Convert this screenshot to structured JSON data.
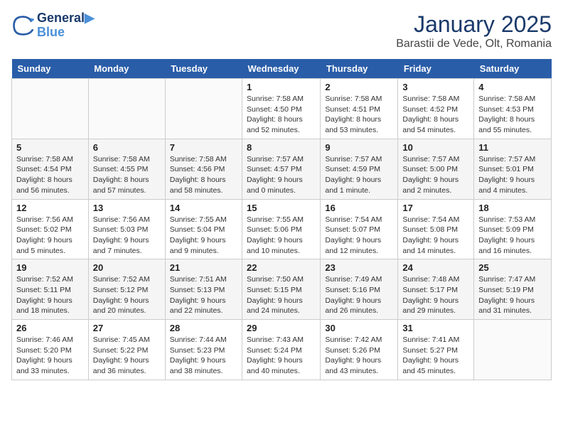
{
  "header": {
    "logo_line1": "General",
    "logo_line2": "Blue",
    "month": "January 2025",
    "location": "Barastii de Vede, Olt, Romania"
  },
  "weekdays": [
    "Sunday",
    "Monday",
    "Tuesday",
    "Wednesday",
    "Thursday",
    "Friday",
    "Saturday"
  ],
  "weeks": [
    [
      {
        "day": "",
        "info": ""
      },
      {
        "day": "",
        "info": ""
      },
      {
        "day": "",
        "info": ""
      },
      {
        "day": "1",
        "info": "Sunrise: 7:58 AM\nSunset: 4:50 PM\nDaylight: 8 hours and 52 minutes."
      },
      {
        "day": "2",
        "info": "Sunrise: 7:58 AM\nSunset: 4:51 PM\nDaylight: 8 hours and 53 minutes."
      },
      {
        "day": "3",
        "info": "Sunrise: 7:58 AM\nSunset: 4:52 PM\nDaylight: 8 hours and 54 minutes."
      },
      {
        "day": "4",
        "info": "Sunrise: 7:58 AM\nSunset: 4:53 PM\nDaylight: 8 hours and 55 minutes."
      }
    ],
    [
      {
        "day": "5",
        "info": "Sunrise: 7:58 AM\nSunset: 4:54 PM\nDaylight: 8 hours and 56 minutes."
      },
      {
        "day": "6",
        "info": "Sunrise: 7:58 AM\nSunset: 4:55 PM\nDaylight: 8 hours and 57 minutes."
      },
      {
        "day": "7",
        "info": "Sunrise: 7:58 AM\nSunset: 4:56 PM\nDaylight: 8 hours and 58 minutes."
      },
      {
        "day": "8",
        "info": "Sunrise: 7:57 AM\nSunset: 4:57 PM\nDaylight: 9 hours and 0 minutes."
      },
      {
        "day": "9",
        "info": "Sunrise: 7:57 AM\nSunset: 4:59 PM\nDaylight: 9 hours and 1 minute."
      },
      {
        "day": "10",
        "info": "Sunrise: 7:57 AM\nSunset: 5:00 PM\nDaylight: 9 hours and 2 minutes."
      },
      {
        "day": "11",
        "info": "Sunrise: 7:57 AM\nSunset: 5:01 PM\nDaylight: 9 hours and 4 minutes."
      }
    ],
    [
      {
        "day": "12",
        "info": "Sunrise: 7:56 AM\nSunset: 5:02 PM\nDaylight: 9 hours and 5 minutes."
      },
      {
        "day": "13",
        "info": "Sunrise: 7:56 AM\nSunset: 5:03 PM\nDaylight: 9 hours and 7 minutes."
      },
      {
        "day": "14",
        "info": "Sunrise: 7:55 AM\nSunset: 5:04 PM\nDaylight: 9 hours and 9 minutes."
      },
      {
        "day": "15",
        "info": "Sunrise: 7:55 AM\nSunset: 5:06 PM\nDaylight: 9 hours and 10 minutes."
      },
      {
        "day": "16",
        "info": "Sunrise: 7:54 AM\nSunset: 5:07 PM\nDaylight: 9 hours and 12 minutes."
      },
      {
        "day": "17",
        "info": "Sunrise: 7:54 AM\nSunset: 5:08 PM\nDaylight: 9 hours and 14 minutes."
      },
      {
        "day": "18",
        "info": "Sunrise: 7:53 AM\nSunset: 5:09 PM\nDaylight: 9 hours and 16 minutes."
      }
    ],
    [
      {
        "day": "19",
        "info": "Sunrise: 7:52 AM\nSunset: 5:11 PM\nDaylight: 9 hours and 18 minutes."
      },
      {
        "day": "20",
        "info": "Sunrise: 7:52 AM\nSunset: 5:12 PM\nDaylight: 9 hours and 20 minutes."
      },
      {
        "day": "21",
        "info": "Sunrise: 7:51 AM\nSunset: 5:13 PM\nDaylight: 9 hours and 22 minutes."
      },
      {
        "day": "22",
        "info": "Sunrise: 7:50 AM\nSunset: 5:15 PM\nDaylight: 9 hours and 24 minutes."
      },
      {
        "day": "23",
        "info": "Sunrise: 7:49 AM\nSunset: 5:16 PM\nDaylight: 9 hours and 26 minutes."
      },
      {
        "day": "24",
        "info": "Sunrise: 7:48 AM\nSunset: 5:17 PM\nDaylight: 9 hours and 29 minutes."
      },
      {
        "day": "25",
        "info": "Sunrise: 7:47 AM\nSunset: 5:19 PM\nDaylight: 9 hours and 31 minutes."
      }
    ],
    [
      {
        "day": "26",
        "info": "Sunrise: 7:46 AM\nSunset: 5:20 PM\nDaylight: 9 hours and 33 minutes."
      },
      {
        "day": "27",
        "info": "Sunrise: 7:45 AM\nSunset: 5:22 PM\nDaylight: 9 hours and 36 minutes."
      },
      {
        "day": "28",
        "info": "Sunrise: 7:44 AM\nSunset: 5:23 PM\nDaylight: 9 hours and 38 minutes."
      },
      {
        "day": "29",
        "info": "Sunrise: 7:43 AM\nSunset: 5:24 PM\nDaylight: 9 hours and 40 minutes."
      },
      {
        "day": "30",
        "info": "Sunrise: 7:42 AM\nSunset: 5:26 PM\nDaylight: 9 hours and 43 minutes."
      },
      {
        "day": "31",
        "info": "Sunrise: 7:41 AM\nSunset: 5:27 PM\nDaylight: 9 hours and 45 minutes."
      },
      {
        "day": "",
        "info": ""
      }
    ]
  ]
}
